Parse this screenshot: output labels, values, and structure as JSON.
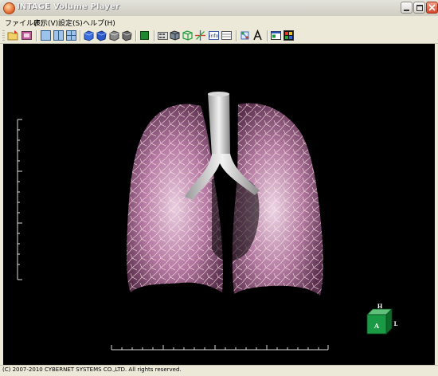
{
  "window": {
    "title": "INTAGE Volume Player"
  },
  "menu": [
    {
      "label": "ファイル(F)"
    },
    {
      "label": "表示(V)"
    },
    {
      "label": "設定(S)"
    },
    {
      "label": "ヘルプ(H)"
    }
  ],
  "toolbar": {
    "buttons": [
      "open-file-icon",
      "export-icon",
      "layout-single-icon",
      "layout-double-icon",
      "layout-quad-icon",
      "volume-blue-icon",
      "volume-blue-rotate-icon",
      "volume-gray-icon",
      "volume-gray-dark-icon",
      "volume-green-icon",
      "animation-icon",
      "volume-cube-icon",
      "wireframe-cube-icon",
      "axes-icon",
      "info-icon",
      "grid-icon",
      "network-icon",
      "text-annotation-icon",
      "window-icon",
      "palette-icon"
    ]
  },
  "viewport": {
    "orientation_cube": {
      "front": "A",
      "top": "H",
      "right": "L"
    }
  },
  "status": {
    "text": "(C) 2007-2010 CYBERNET SYSTEMS CO.,LTD. All rights reserved."
  }
}
